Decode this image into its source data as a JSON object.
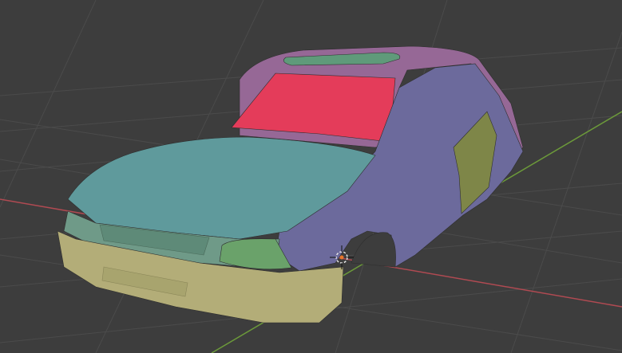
{
  "viewport": {
    "mode": "3D viewport",
    "colors": {
      "background": "#3d3d3d",
      "grid": "#4a4a4a",
      "x_axis": "#b04a52",
      "y_axis": "#6c9a3a",
      "hood": "#5f9a9c",
      "body_side": "#6c6a9c",
      "rear_door": "#7e8648",
      "roof": "#966896",
      "interior": "#e43c5a",
      "bumper": "#b3ad78",
      "front_panel": "#6f9a88",
      "headlight": "#6aa26a",
      "sunroof": "#5f9a7a",
      "cursor": "#e8762c"
    }
  }
}
